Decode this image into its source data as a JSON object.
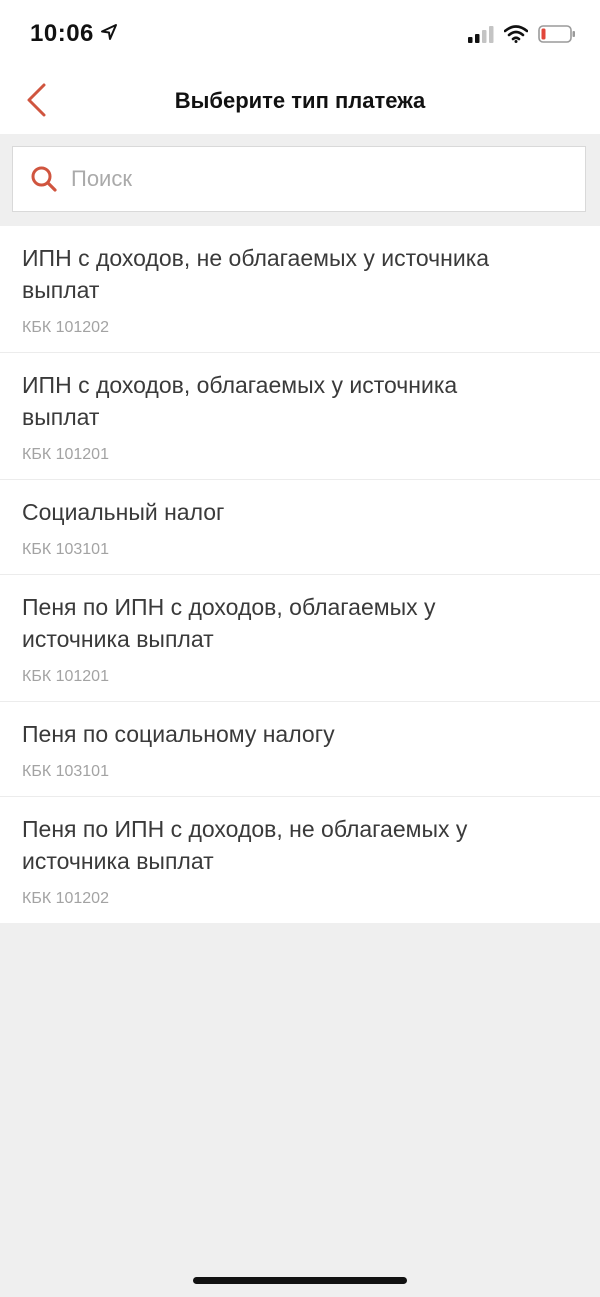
{
  "status_bar": {
    "time": "10:06",
    "location_icon": "location-arrow-icon",
    "signal_icon": "cellular-signal-icon",
    "wifi_icon": "wifi-icon",
    "battery_icon": "battery-low-icon"
  },
  "nav": {
    "back_icon": "chevron-left-icon",
    "title": "Выберите тип платежа"
  },
  "search": {
    "icon": "search-icon",
    "value": "",
    "placeholder": "Поиск"
  },
  "items": [
    {
      "title": "ИПН с доходов, не облагаемых у источника выплат",
      "code": "КБК 101202"
    },
    {
      "title": "ИПН с доходов, облагаемых у источника выплат",
      "code": "КБК 101201"
    },
    {
      "title": "Социальный налог",
      "code": "КБК 103101"
    },
    {
      "title": "Пеня по ИПН с доходов, облагаемых у источника выплат",
      "code": "КБК 101201"
    },
    {
      "title": "Пеня по социальному налогу",
      "code": "КБК 103101"
    },
    {
      "title": "Пеня по ИПН с доходов, не облагаемых у источника выплат",
      "code": "КБК 101202"
    }
  ],
  "colors": {
    "accent": "#d0553f",
    "background": "#efefef",
    "surface": "#ffffff",
    "battery_low": "#e2463a"
  }
}
